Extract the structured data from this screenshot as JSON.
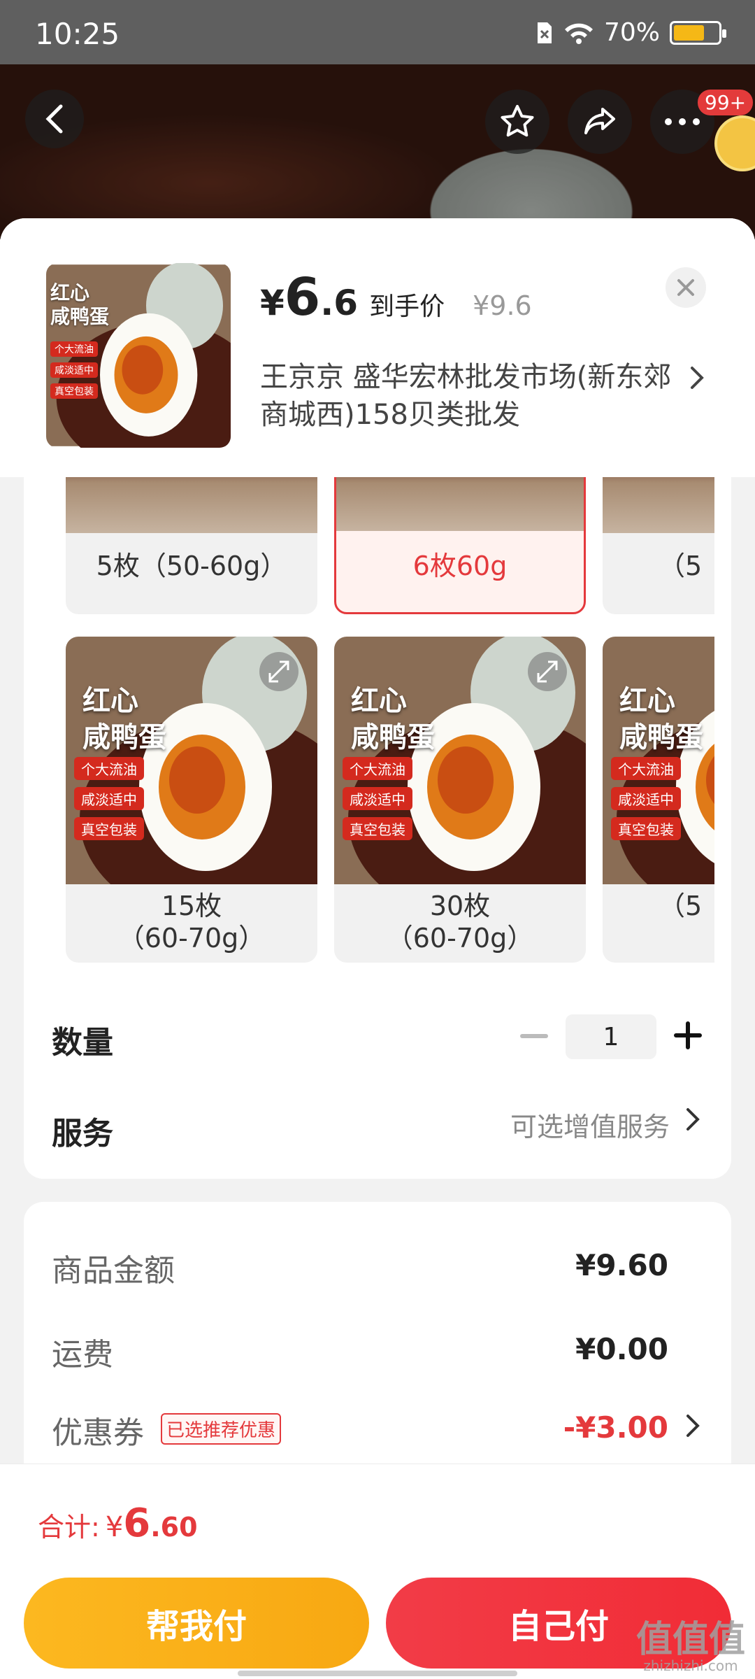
{
  "status_bar": {
    "time": "10:25",
    "battery": "70%",
    "battery_level": 0.7
  },
  "top_actions": {
    "badge": "99+"
  },
  "product": {
    "yen": "¥",
    "price_int": "6",
    "price_dec": ".6",
    "price_label": "到手价",
    "original_price": "¥9.6",
    "shop_name": "王京京 盛华宏林批发市场(新东郊商城西)158贝类批发"
  },
  "product_image": {
    "line1": "红心",
    "line2": "咸鸭蛋",
    "features": [
      "个大流油",
      "咸淡适中",
      "真空包装"
    ]
  },
  "sku_rows": [
    {
      "items": [
        {
          "label": "5枚（50-60g）",
          "selected": false
        },
        {
          "label": "6枚60g",
          "selected": true
        },
        {
          "label": "（5",
          "selected": false
        }
      ]
    },
    {
      "items": [
        {
          "label": "15枚\n（60-70g）",
          "label_a": "15枚",
          "label_b": "（60-70g）"
        },
        {
          "label_a": "30枚",
          "label_b": "（60-70g）"
        },
        {
          "label_a": "",
          "label_b": "（5"
        }
      ]
    }
  ],
  "quantity": {
    "label": "数量",
    "value": "1"
  },
  "service": {
    "label": "服务",
    "value": "可选增值服务"
  },
  "summary": {
    "goods_label": "商品金额",
    "goods_value": "¥9.60",
    "shipping_label": "运费",
    "shipping_value": "¥0.00",
    "coupon_label": "优惠券",
    "coupon_tag": "已选推荐优惠",
    "coupon_value": "-¥3.00"
  },
  "footer": {
    "total_label": "合计:",
    "total_yen": "¥",
    "total_int": "6",
    "total_dec": ".60",
    "help_pay": "帮我付",
    "self_pay": "自己付"
  },
  "watermark": {
    "main": "值值值",
    "sub": "zhizhizhi.com"
  },
  "colors": {
    "accent_red": "#e4393c",
    "pay_yellow": "#fcb820",
    "pay_red": "#f23c47"
  }
}
